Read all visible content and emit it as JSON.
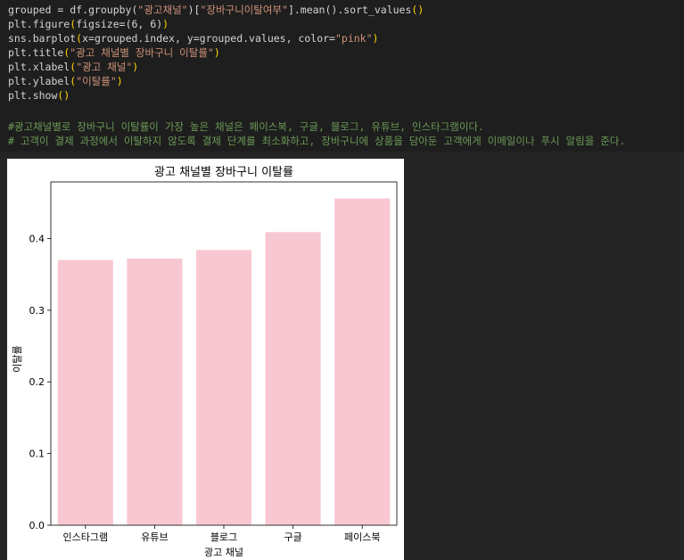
{
  "code_cell": {
    "lines": [
      [
        {
          "t": "grouped = df.groupby(",
          "c": "plain"
        },
        {
          "t": "\"광고채널\"",
          "c": "str"
        },
        {
          "t": ")[",
          "c": "plain"
        },
        {
          "t": "\"장바구니이탈여부\"",
          "c": "str"
        },
        {
          "t": "].mean().sort_values",
          "c": "plain"
        },
        {
          "t": "()",
          "c": "paren"
        }
      ],
      [
        {
          "t": "plt.figure",
          "c": "plain"
        },
        {
          "t": "(",
          "c": "paren"
        },
        {
          "t": "figsize=(6, 6)",
          "c": "plain"
        },
        {
          "t": ")",
          "c": "paren"
        }
      ],
      [
        {
          "t": "sns.barplot",
          "c": "plain"
        },
        {
          "t": "(",
          "c": "paren"
        },
        {
          "t": "x=grouped.index, y=grouped.values, color=",
          "c": "plain"
        },
        {
          "t": "\"pink\"",
          "c": "str"
        },
        {
          "t": ")",
          "c": "paren"
        }
      ],
      [
        {
          "t": "plt.title",
          "c": "plain"
        },
        {
          "t": "(",
          "c": "paren"
        },
        {
          "t": "\"광고 채널별 장바구니 이탈률\"",
          "c": "str"
        },
        {
          "t": ")",
          "c": "paren"
        }
      ],
      [
        {
          "t": "plt.xlabel",
          "c": "plain"
        },
        {
          "t": "(",
          "c": "paren"
        },
        {
          "t": "\"광고 채널\"",
          "c": "str"
        },
        {
          "t": ")",
          "c": "paren"
        }
      ],
      [
        {
          "t": "plt.ylabel",
          "c": "plain"
        },
        {
          "t": "(",
          "c": "paren"
        },
        {
          "t": "\"이탈률\"",
          "c": "str"
        },
        {
          "t": ")",
          "c": "paren"
        }
      ],
      [
        {
          "t": "plt.show",
          "c": "plain"
        },
        {
          "t": "()",
          "c": "paren"
        }
      ],
      [],
      [
        {
          "t": "#광고채널별로 장바구니 이탈률이 가장 높은 채널은 페이스북, 구글, 블로그, 유튜브, 인스타그램이다.",
          "c": "comment"
        }
      ],
      [
        {
          "t": "# 고객이 결제 과정에서 이탈하지 않도록 결제 단계를 최소화하고, 장바구니에 상품을 담아둔 고객에게 이메일이나 푸시 알림을 준다.",
          "c": "comment"
        }
      ]
    ]
  },
  "colors": {
    "editor_bg": "#1e1e1e",
    "output_bg": "#252526",
    "bar_fill": "#f8c8d2",
    "string": "#ce9178",
    "comment": "#6a9955",
    "paren": "#ffd700"
  },
  "chart_data": {
    "type": "bar",
    "title": "광고 채널별 장바구니 이탈률",
    "xlabel": "광고 채널",
    "ylabel": "이탈률",
    "categories": [
      "인스타그램",
      "유튜브",
      "블로그",
      "구글",
      "페이스북"
    ],
    "values": [
      0.37,
      0.372,
      0.384,
      0.409,
      0.456
    ],
    "ylim": [
      0,
      0.479
    ],
    "yticks": [
      0.0,
      0.1,
      0.2,
      0.3,
      0.4
    ],
    "ytick_labels": [
      "0.0",
      "0.1",
      "0.2",
      "0.3",
      "0.4"
    ],
    "grid": false,
    "bar_color": "#f8c8d2"
  }
}
